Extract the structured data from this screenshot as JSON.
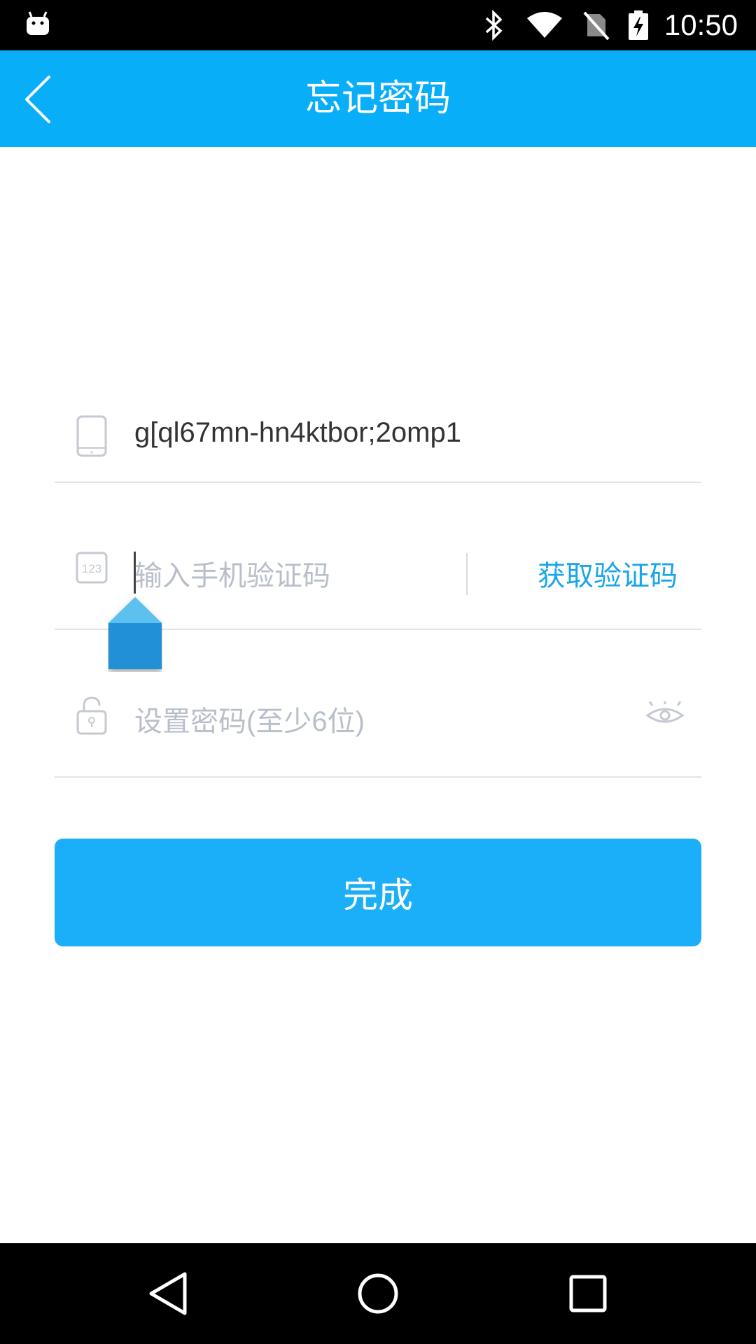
{
  "status_bar": {
    "time": "10:50",
    "icons": [
      "android-icon",
      "bluetooth-icon",
      "wifi-icon",
      "no-sim-icon",
      "battery-charging-icon"
    ]
  },
  "app_bar": {
    "title": "忘记密码",
    "back_icon": "chevron-left-icon"
  },
  "form": {
    "phone": {
      "icon": "phone-icon",
      "value": "g[ql67mn-hn4ktbor;2omp1"
    },
    "code": {
      "icon": "numeric-123-icon",
      "placeholder": "输入手机验证码",
      "get_code_label": "获取验证码"
    },
    "password": {
      "icon": "lock-icon",
      "placeholder": "设置密码(至少6位)",
      "toggle_icon": "eye-icon"
    }
  },
  "submit_label": "完成",
  "colors": {
    "primary": "#09aef8",
    "button": "#1caff9",
    "link": "#18a5ea",
    "placeholder": "#b9bfca"
  },
  "nav_bar": {
    "icons": [
      "back-triangle-icon",
      "home-circle-icon",
      "recents-square-icon"
    ]
  }
}
